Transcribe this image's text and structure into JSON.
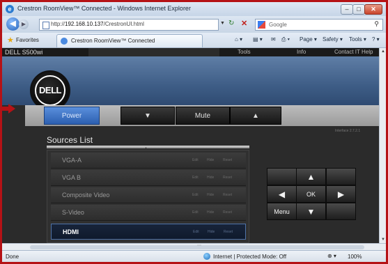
{
  "window": {
    "title": "Crestron RoomView™ Connected - Windows Internet Explorer",
    "min": "–",
    "max": "□",
    "close": "✕",
    "ie_glyph": "e"
  },
  "nav": {
    "url_prefix": "http://",
    "url_host": "192.168.10.137",
    "url_path": "/CrestronUI.html",
    "search_placeholder": "Google"
  },
  "favorites": {
    "label": "Favorites",
    "tab_title": "Crestron RoomView™ Connected",
    "commands": [
      "Page ▾",
      "Safety ▾",
      "Tools ▾"
    ]
  },
  "page": {
    "device_name": "DELL S500wi",
    "top_menu": [
      "Tools",
      "Info",
      "Contact IT Help"
    ],
    "logo_text": "DELL",
    "buttons": {
      "power": "Power",
      "vol_down": "▼",
      "mute": "Mute",
      "vol_up": "▲"
    },
    "version": "Interface 2.7.2.1",
    "sources_title": "Sources List",
    "sources": [
      {
        "label": "VGA-A",
        "active": false
      },
      {
        "label": "VGA B",
        "active": false
      },
      {
        "label": "Composite Video",
        "active": false
      },
      {
        "label": "S-Video",
        "active": false
      },
      {
        "label": "HDMI",
        "active": true
      }
    ],
    "row_actions": [
      "Edit",
      "Hide",
      "Reset"
    ],
    "dpad": {
      "up": "▲",
      "left": "◀",
      "ok": "OK",
      "right": "▶",
      "menu": "Menu",
      "down": "▼"
    }
  },
  "status": {
    "left": "Done",
    "zone": "Internet | Protected Mode: Off",
    "zoom": "100%"
  },
  "colors": {
    "frame_border": "#b51216",
    "power_button": "#3f74c6",
    "banner": "#4b6b95",
    "active_source_border": "#4f73a8"
  }
}
